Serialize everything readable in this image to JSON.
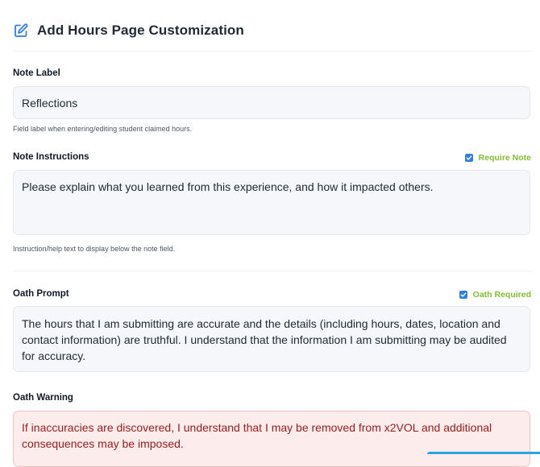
{
  "header": {
    "title": "Add Hours Page Customization",
    "icon": "edit-icon"
  },
  "note_label": {
    "label": "Note Label",
    "value": "Reflections",
    "help": "Field label when entering/editing student claimed hours."
  },
  "note_instructions": {
    "label": "Note Instructions",
    "value": "Please explain what you learned from this experience, and how it impacted others.",
    "help": "Instruction/help text to display below the note field.",
    "checkbox_label": "Require Note",
    "checkbox_checked": true
  },
  "oath_prompt": {
    "label": "Oath Prompt",
    "value": "The hours that I am submitting are accurate and the details (including hours, dates, location and contact information) are truthful. I understand that the information I am submitting may be audited for accuracy.",
    "checkbox_label": "Oath Required",
    "checkbox_checked": true
  },
  "oath_warning": {
    "label": "Oath Warning",
    "value": "If inaccuracies are discovered, I understand that I may be removed from x2VOL and additional consequences may be imposed."
  },
  "colors": {
    "accent_blue": "#2f7fe6",
    "checkbox_label_green": "#7fbf2f",
    "warning_text": "#9b1c1c",
    "warning_bg": "#fdecec"
  }
}
